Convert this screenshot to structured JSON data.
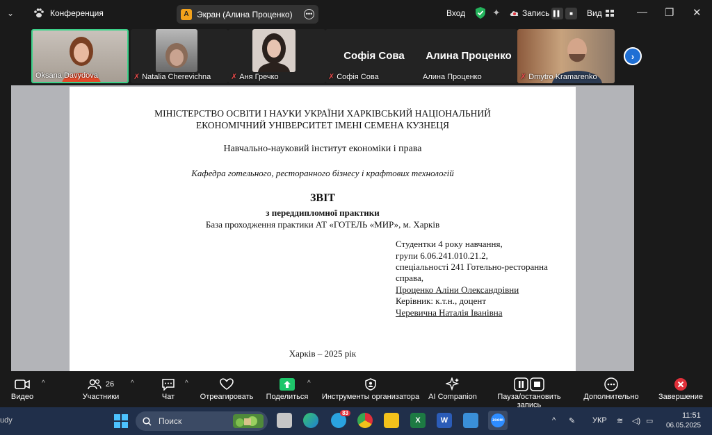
{
  "topbar": {
    "conference_label": "Конференция",
    "screen_badge": "A",
    "screen_label": "Экран (Алина Проценко)",
    "login_label": "Вход",
    "record_label": "Запись",
    "view_label": "Вид"
  },
  "participants": [
    {
      "name": "Oksana Davydova",
      "muted": false,
      "active": true
    },
    {
      "name": "Natalia Cherevichna",
      "muted": true
    },
    {
      "name": "Аня Гречко",
      "muted": true
    },
    {
      "name": "Софія Сова",
      "big": "Софія Сова",
      "muted": true
    },
    {
      "name": "Алина Проценко",
      "big": "Алина Проценко",
      "muted": false
    },
    {
      "name": "Dmytro Kramarenko",
      "muted": true
    }
  ],
  "doc": {
    "ministry_line1": "МІНІСТЕРСТВО ОСВІТИ І НАУКИ УКРАЇНИ ХАРКІВСЬКИЙ НАЦІОНАЛЬНИЙ",
    "ministry_line2": "ЕКОНОМІЧНИЙ УНІВЕРСИТЕТ ІМЕНІ СЕМЕНА КУЗНЕЦЯ",
    "institute": "Навчально-науковий інститут економіки і права",
    "department": "Кафедра готельного, ресторанного бізнесу і крафтових технологій",
    "report_title": "ЗВІТ",
    "report_subtitle": "з переддипломної практики",
    "base": "База проходження практики АТ «ГОТЕЛЬ «МИР», м. Харків",
    "student_line1": "Студентки 4 року навчання,",
    "student_line2": "групи 6.06.241.010.21.2,",
    "student_line3": "спеціальності 241 Готельно-ресторанна",
    "student_line4": "справа,",
    "student_name": "Проценко Аліни Олександрівни",
    "supervisor_label": "Керівник: к.т.н., доцент",
    "supervisor_name": "Черевична Наталія Іванівна",
    "city_year": "Харків – 2025 рік"
  },
  "toolbar": {
    "video": "Видео",
    "participants": "Участники",
    "participants_count": "26",
    "chat": "Чат",
    "react": "Отреагировать",
    "share": "Поделиться",
    "host_tools": "Инструменты организатора",
    "ai": "AI Companion",
    "pause": "Пауза/остановить запись",
    "more": "Дополнительно",
    "end": "Завершение"
  },
  "taskbar": {
    "left_fragment": "udy",
    "search_placeholder": "Поиск",
    "telegram_badge": "83",
    "lang": "УКР",
    "time": "11:51",
    "date": "06.05.2025"
  },
  "colors": {
    "active_border": "#3dd28a",
    "share_green": "#1ec66a",
    "end_red": "#e0303a",
    "next_blue": "#1f6fd4"
  }
}
